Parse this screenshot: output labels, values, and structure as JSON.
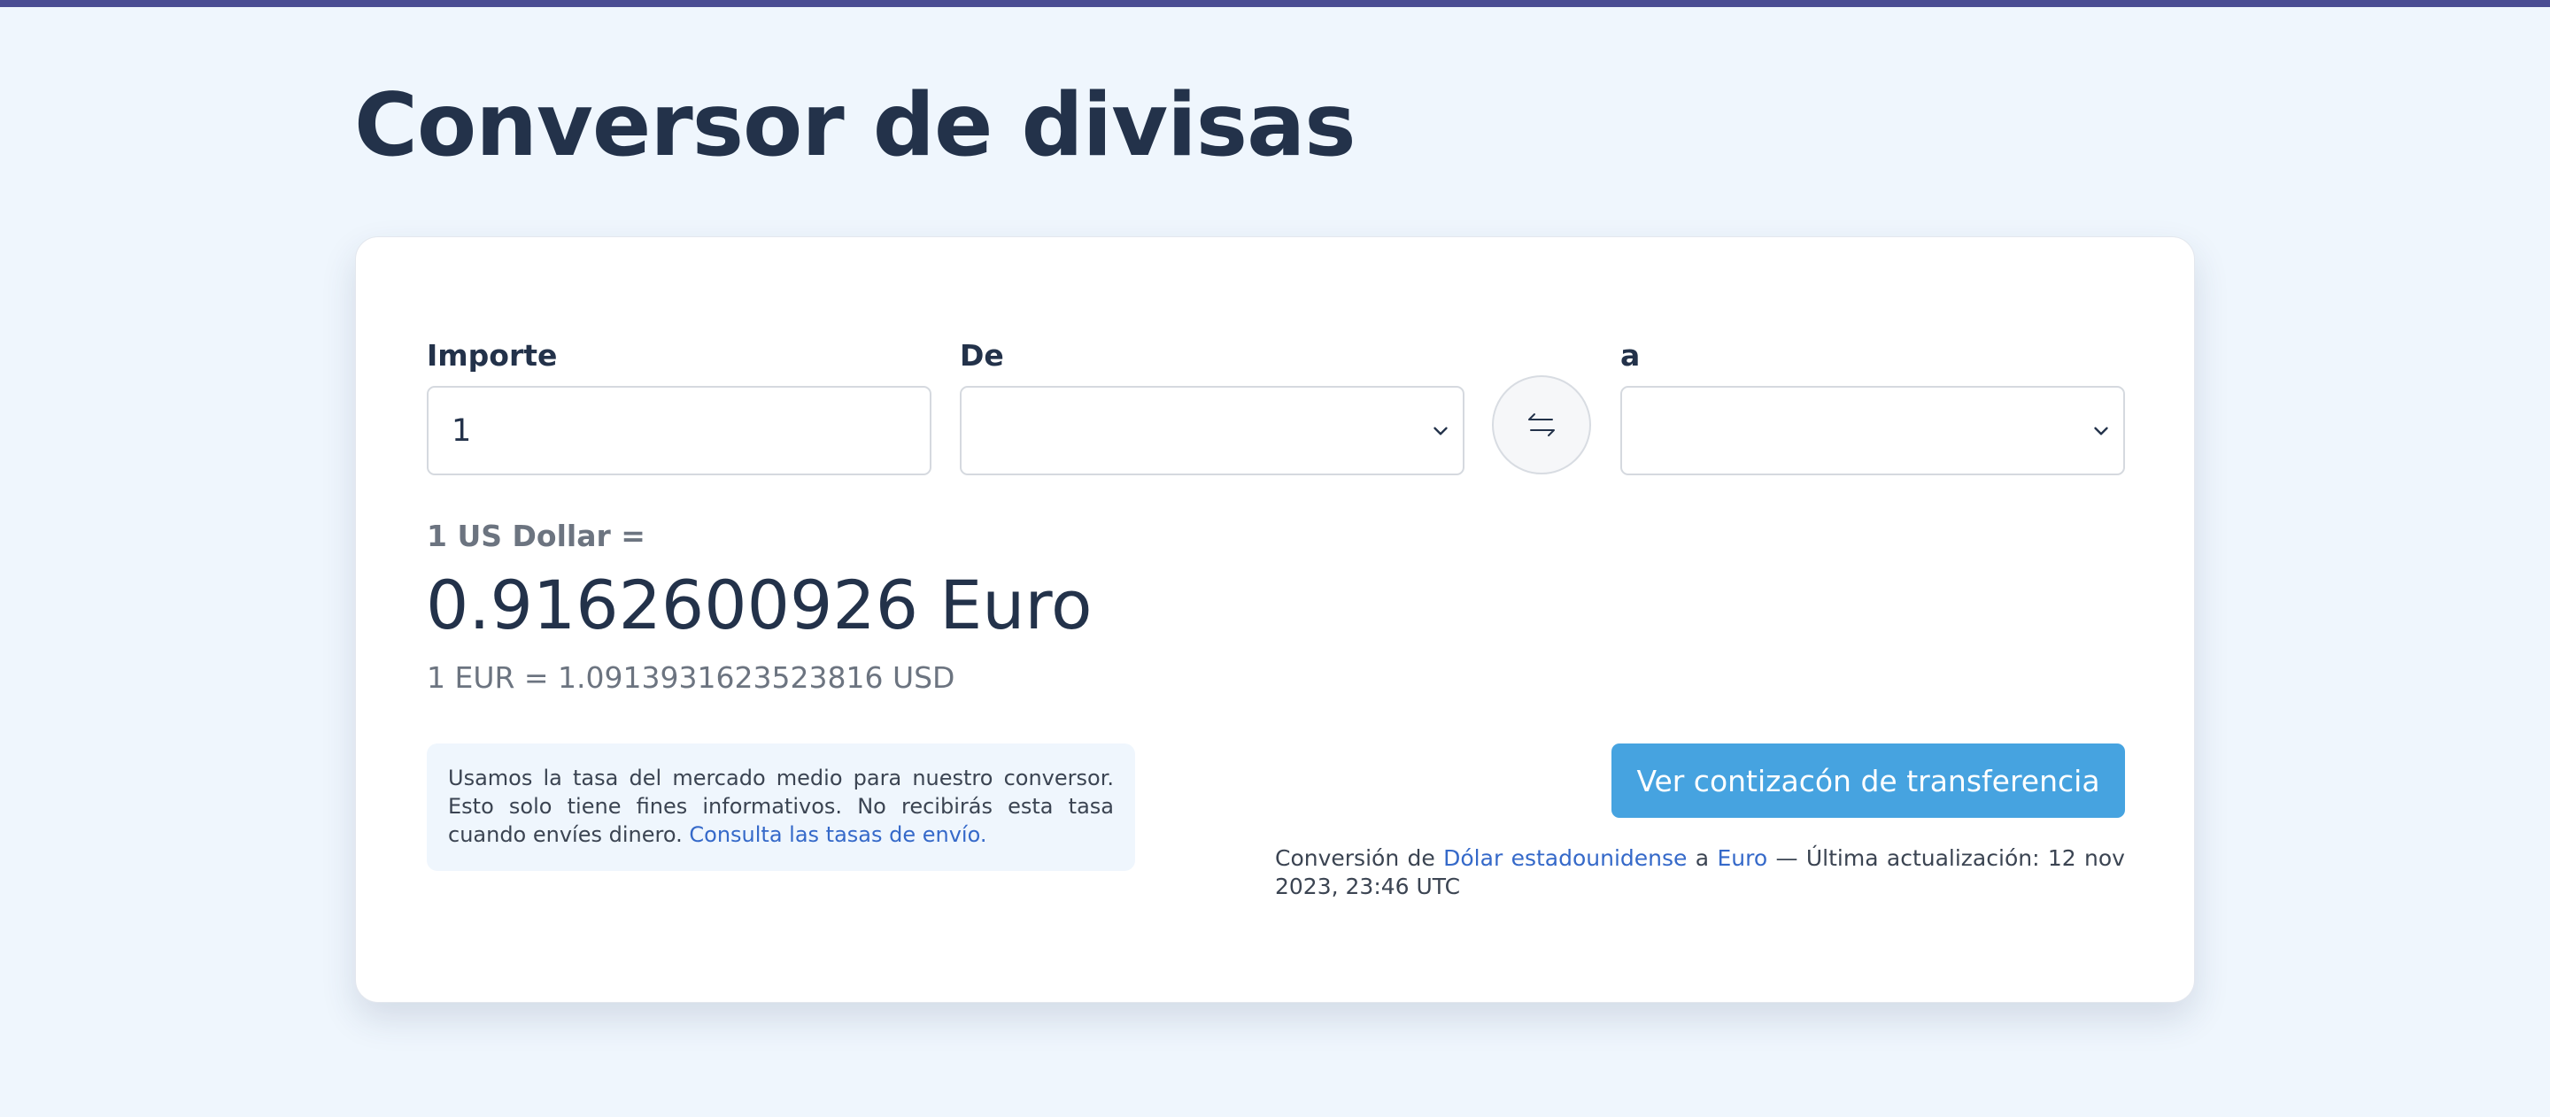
{
  "page": {
    "title": "Conversor de divisas"
  },
  "form": {
    "amount_label": "Importe",
    "amount_value": "1",
    "from_label": "De",
    "from_value": "",
    "to_label": "a",
    "to_value": ""
  },
  "icons": {
    "swap": "swap-arrows-icon",
    "dropdown": "chevron-down-icon"
  },
  "result": {
    "from_text": "1 US Dollar =",
    "converted_text": "0.9162600926 Euro",
    "inverse_text": "1 EUR = 1.0913931623523816 USD"
  },
  "disclaimer": {
    "text": "Usamos la tasa del mercado medio para nuestro conversor. Esto solo tiene fines informativos. No recibirás esta tasa cuando envíes dinero.",
    "link_text": "Consulta las tasas de envío."
  },
  "actions": {
    "quote_button_label": "Ver contizacón de transferencia"
  },
  "conversion_info": {
    "prefix": "Conversión de",
    "from_link": "Dólar estadounidense",
    "connector": "a",
    "to_link": "Euro",
    "suffix": "— Última actualización: 12 nov 2023, 23:46 UTC"
  },
  "colors": {
    "page_background": "#eff6fd",
    "top_bar": "#4a4d93",
    "primary_button": "#46a3e0",
    "link": "#3569c9",
    "heading_text": "#23324a",
    "muted_text": "#6c7480"
  }
}
